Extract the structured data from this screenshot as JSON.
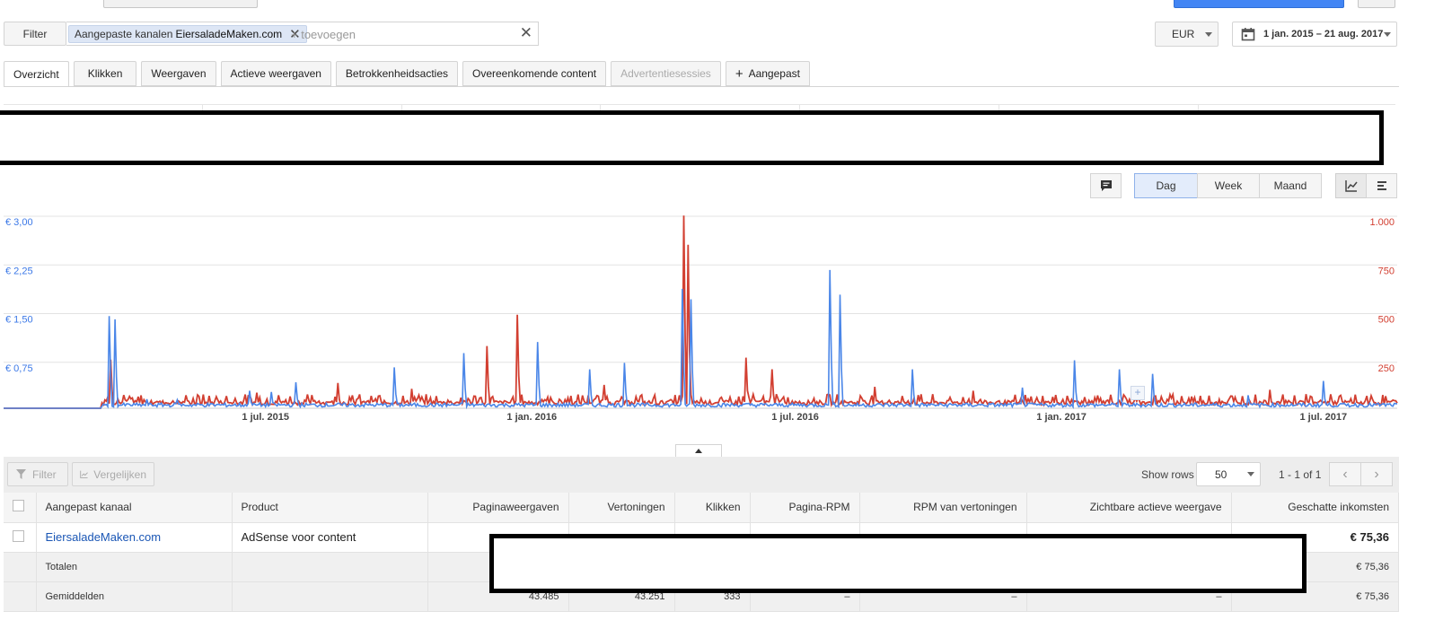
{
  "filter_bar": {
    "filter_label": "Filter",
    "chip_prefix": "Aangepaste kanalen",
    "chip_value": "EiersaladeMaken.com",
    "add_placeholder": "+ toevoegen"
  },
  "currency": {
    "value": "EUR"
  },
  "date_range": {
    "value": "1 jan. 2015 – 21 aug. 2017"
  },
  "tabs": [
    {
      "label": "Overzicht",
      "active": true,
      "disabled": false
    },
    {
      "label": "Klikken",
      "active": false,
      "disabled": false
    },
    {
      "label": "Weergaven",
      "active": false,
      "disabled": false
    },
    {
      "label": "Actieve weergaven",
      "active": false,
      "disabled": false
    },
    {
      "label": "Betrokkenheidsacties",
      "active": false,
      "disabled": false
    },
    {
      "label": "Overeenkomende content",
      "active": false,
      "disabled": false
    },
    {
      "label": "Advertentiesessies",
      "active": false,
      "disabled": true
    },
    {
      "label": "Aangepast",
      "active": false,
      "disabled": false
    }
  ],
  "granularity": {
    "day": "Dag",
    "week": "Week",
    "month": "Maand",
    "selected": "Dag"
  },
  "chart_data": {
    "type": "line",
    "x_ticks": [
      "1 jul. 2015",
      "1 jan. 2016",
      "1 jul. 2016",
      "1 jan. 2017",
      "1 jul. 2017"
    ],
    "x_range": [
      "2015-01-01",
      "2017-08-21"
    ],
    "y_left": {
      "ticks": [
        "€ 3,00",
        "€ 2,25",
        "€ 1,50",
        "€ 0,75"
      ],
      "range": [
        0,
        3.0
      ],
      "color": "#3b78e7"
    },
    "y_right": {
      "ticks": [
        "1.000",
        "750",
        "500",
        "250"
      ],
      "range": [
        0,
        1000
      ],
      "color": "#d23f31"
    },
    "series": [
      {
        "axis": "left",
        "color": "#4a86e8",
        "peaks": [
          [
            "2015-03-15",
            1.42
          ],
          [
            "2015-03-19",
            1.37
          ],
          [
            "2015-04-10",
            0.14
          ],
          [
            "2015-05-01",
            0.13
          ],
          [
            "2015-06-20",
            0.27
          ],
          [
            "2015-07-05",
            0.25
          ],
          [
            "2015-07-22",
            0.4
          ],
          [
            "2015-09-28",
            0.63
          ],
          [
            "2015-11-15",
            0.85
          ],
          [
            "2016-01-05",
            1.02
          ],
          [
            "2016-02-10",
            0.6
          ],
          [
            "2016-03-05",
            0.7
          ],
          [
            "2016-04-14",
            1.84
          ],
          [
            "2016-04-20",
            1.68
          ],
          [
            "2016-07-25",
            2.13
          ],
          [
            "2016-08-01",
            1.75
          ],
          [
            "2016-09-20",
            0.6
          ],
          [
            "2016-12-05",
            0.32
          ],
          [
            "2017-01-10",
            0.74
          ],
          [
            "2017-02-10",
            0.6
          ],
          [
            "2017-03-05",
            0.53
          ],
          [
            "2017-07-01",
            0.42
          ],
          [
            "2017-05-10",
            0.2
          ]
        ],
        "baseline": 0.02
      },
      {
        "axis": "right",
        "color": "#d23f31",
        "peaks": [
          [
            "2015-03-16",
            250
          ],
          [
            "2015-06-25",
            80
          ],
          [
            "2015-08-20",
            130
          ],
          [
            "2015-10-10",
            100
          ],
          [
            "2015-12-01",
            320
          ],
          [
            "2015-12-22",
            480
          ],
          [
            "2016-02-20",
            120
          ],
          [
            "2016-04-15",
            990
          ],
          [
            "2016-04-18",
            840
          ],
          [
            "2016-05-28",
            260
          ],
          [
            "2016-06-15",
            200
          ],
          [
            "2016-08-25",
            110
          ],
          [
            "2016-11-01",
            90
          ],
          [
            "2017-04-01",
            60
          ],
          [
            "2017-05-25",
            95
          ]
        ],
        "baseline": 18,
        "noise": 55
      }
    ]
  },
  "table_toolbar": {
    "filter_label": "Filter",
    "compare_label": "Vergelijken",
    "show_rows_label": "Show rows",
    "rows_value": "50",
    "pagination": "1 - 1 of 1"
  },
  "table": {
    "headers": [
      "Aangepast kanaal",
      "Product",
      "Paginaweergaven",
      "Vertoningen",
      "Klikken",
      "Pagina-RPM",
      "RPM van vertoningen",
      "Zichtbare actieve weergave",
      "Geschatte inkomsten"
    ],
    "row": {
      "channel": "EiersaladeMaken.com",
      "product": "AdSense voor content",
      "income": "€ 75,36"
    },
    "totals": {
      "label": "Totalen",
      "income": "€ 75,36"
    },
    "averages": {
      "label": "Gemiddelden",
      "pageviews": "43.485",
      "impressions": "43.251",
      "clicks": "333",
      "page_rpm": "–",
      "imp_rpm": "–",
      "viewable": "–",
      "income": "€ 75,36"
    }
  }
}
